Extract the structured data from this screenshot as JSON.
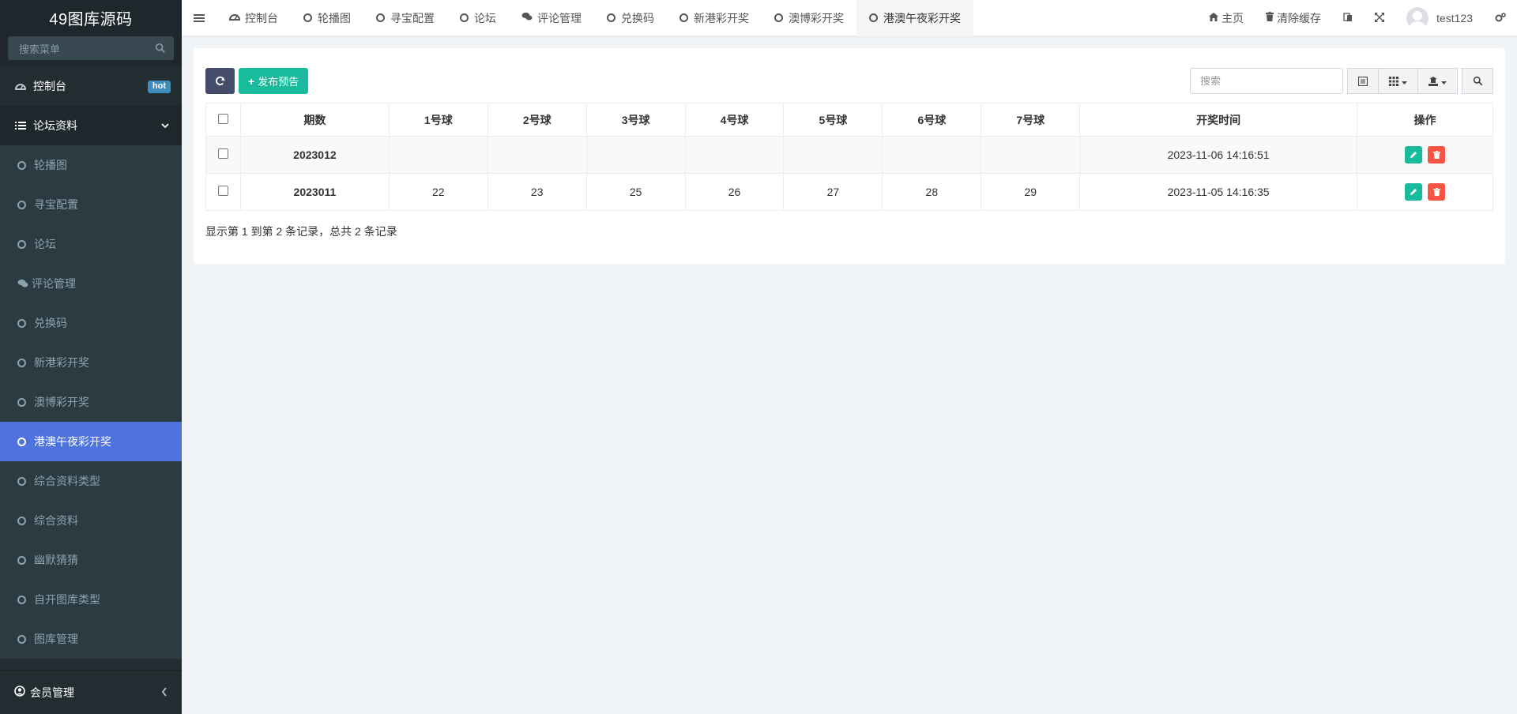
{
  "app": {
    "title": "49图库源码"
  },
  "sidebar": {
    "search_placeholder": "搜索菜单",
    "dashboard": {
      "label": "控制台",
      "badge": "hot",
      "badge_color": "#3c8dbc"
    },
    "group": {
      "label": "论坛资料"
    },
    "items": [
      {
        "label": "轮播图"
      },
      {
        "label": "寻宝配置"
      },
      {
        "label": "论坛"
      },
      {
        "label": "评论管理"
      },
      {
        "label": "兑换码"
      },
      {
        "label": "新港彩开奖"
      },
      {
        "label": "澳博彩开奖"
      },
      {
        "label": "港澳午夜彩开奖",
        "active": true
      },
      {
        "label": "综合资料类型"
      },
      {
        "label": "综合资料"
      },
      {
        "label": "幽默猜猜"
      },
      {
        "label": "自开图库类型"
      },
      {
        "label": "图库管理"
      }
    ],
    "footer": {
      "label": "会员管理"
    }
  },
  "navbar": {
    "tabs": [
      {
        "label": "控制台",
        "icon": "dashboard-icon"
      },
      {
        "label": "轮播图",
        "icon": "circle-icon"
      },
      {
        "label": "寻宝配置",
        "icon": "circle-icon"
      },
      {
        "label": "论坛",
        "icon": "circle-icon"
      },
      {
        "label": "评论管理",
        "icon": "comments-icon"
      },
      {
        "label": "兑换码",
        "icon": "circle-icon"
      },
      {
        "label": "新港彩开奖",
        "icon": "circle-icon"
      },
      {
        "label": "澳博彩开奖",
        "icon": "circle-icon"
      },
      {
        "label": "港澳午夜彩开奖",
        "icon": "circle-icon",
        "active": true
      }
    ],
    "home_label": "主页",
    "clear_cache_label": "清除缓存",
    "username": "test123"
  },
  "toolbar": {
    "add_label": "发布预告",
    "search_placeholder": "搜索"
  },
  "table": {
    "columns": [
      "期数",
      "1号球",
      "2号球",
      "3号球",
      "4号球",
      "5号球",
      "6号球",
      "7号球",
      "开奖时间",
      "操作"
    ],
    "rows": [
      {
        "issue": "2023012",
        "balls": [
          "",
          "",
          "",
          "",
          "",
          "",
          ""
        ],
        "time": "2023-11-06 14:16:51"
      },
      {
        "issue": "2023011",
        "balls": [
          "22",
          "23",
          "25",
          "26",
          "27",
          "28",
          "29"
        ],
        "time": "2023-11-05 14:16:35"
      }
    ],
    "summary": "显示第 1 到第 2 条记录，总共 2 条记录"
  },
  "colors": {
    "sidebar_bg": "#222d32",
    "active_item": "#4e73df",
    "add_button": "#18bc9c",
    "refresh_button": "#444c69",
    "issue_text": "#e61c1c",
    "edit_button": "#18bc9c",
    "delete_button": "#f75444"
  }
}
